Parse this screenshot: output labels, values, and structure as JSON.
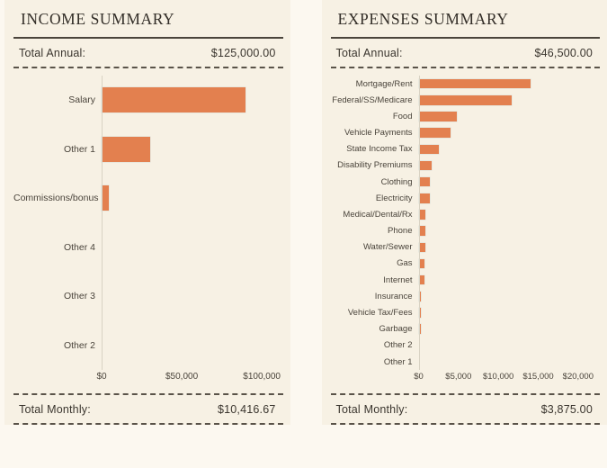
{
  "panels": {
    "income": {
      "title": "INCOME SUMMARY",
      "total_annual_label": "Total Annual:",
      "total_annual_value": "$125,000.00",
      "total_monthly_label": "Total Monthly:",
      "total_monthly_value": "$10,416.67"
    },
    "expenses": {
      "title": "EXPENSES SUMMARY",
      "total_annual_label": "Total Annual:",
      "total_annual_value": "$46,500.00",
      "total_monthly_label": "Total Monthly:",
      "total_monthly_value": "$3,875.00"
    }
  },
  "colors": {
    "bar": "#E3804F",
    "panel_bg": "#F7F1E4",
    "page_bg": "#FCF8F0",
    "rule": "#4A443B",
    "text": "#3A352E"
  },
  "chart_data": [
    {
      "type": "bar",
      "orientation": "horizontal",
      "title": "INCOME SUMMARY",
      "xlabel": "",
      "ylabel": "",
      "grid": false,
      "legend": "none",
      "xlim": [
        0,
        112000
      ],
      "tick_labels": [
        "$0",
        "$50,000",
        "$100,000"
      ],
      "ticks": [
        0,
        50000,
        100000
      ],
      "categories": [
        "Salary",
        "Other 1",
        "Commissions/bonus",
        "Other 4",
        "Other 3",
        "Other 2"
      ],
      "values": [
        90000,
        30500,
        4500,
        0,
        0,
        0
      ]
    },
    {
      "type": "bar",
      "orientation": "horizontal",
      "title": "EXPENSES SUMMARY",
      "xlabel": "",
      "ylabel": "",
      "grid": false,
      "legend": "none",
      "xlim": [
        0,
        22500
      ],
      "tick_labels": [
        "$0",
        "$5,000",
        "$10,000",
        "$15,000",
        "$20,000"
      ],
      "ticks": [
        0,
        5000,
        10000,
        15000,
        20000
      ],
      "categories": [
        "Mortgage/Rent",
        "Federal/SS/Medicare",
        "Food",
        "Vehicle Payments",
        "State Income Tax",
        "Disability Premiums",
        "Clothing",
        "Electricity",
        "Medical/Dental/Rx",
        "Phone",
        "Water/Sewer",
        "Gas",
        "Internet",
        "Insurance",
        "Vehicle Tax/Fees",
        "Garbage",
        "Other 2",
        "Other 1"
      ],
      "values": [
        14000,
        11700,
        4800,
        4000,
        2500,
        1600,
        1400,
        1400,
        900,
        900,
        800,
        780,
        720,
        300,
        300,
        250,
        0,
        0
      ]
    }
  ]
}
